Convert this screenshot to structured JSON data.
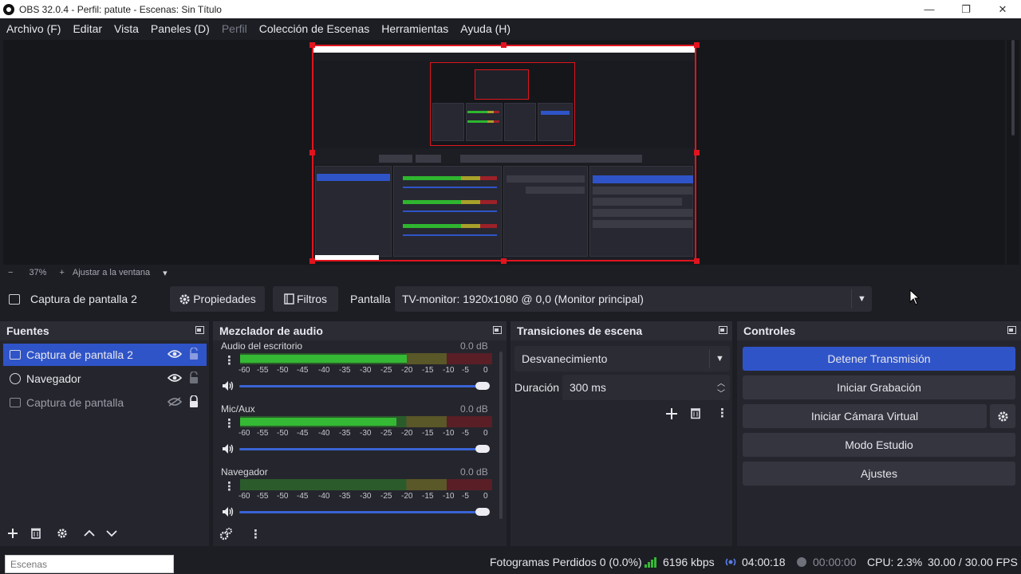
{
  "window": {
    "title": "OBS 32.0.4 - Perfil: patute - Escenas: Sin Título",
    "minimize": "—",
    "restore": "❐",
    "close": "✕"
  },
  "menu": [
    "Archivo (F)",
    "Editar",
    "Vista",
    "Paneles (D)",
    "Perfil",
    "Colección de Escenas",
    "Herramientas",
    "Ayuda (H)"
  ],
  "zoom": {
    "minus": "−",
    "value": "37%",
    "plus": "+",
    "fit": "Ajustar a la ventana",
    "dropdown": "▾"
  },
  "source_toolbar": {
    "selected_source": "Captura de pantalla 2",
    "properties": "Propiedades",
    "filters": "Filtros",
    "display_label": "Pantalla",
    "display_value": "TV-monitor: 1920x1080 @ 0,0 (Monitor principal)"
  },
  "sources": {
    "title": "Fuentes",
    "items": [
      {
        "label": "Captura de pantalla 2",
        "icon": "monitor-icon",
        "visible": true,
        "locked": false,
        "selected": true
      },
      {
        "label": "Navegador",
        "icon": "globe-icon",
        "visible": true,
        "locked": false,
        "selected": false
      },
      {
        "label": "Captura de pantalla",
        "icon": "monitor-icon",
        "visible": false,
        "locked": true,
        "selected": false
      }
    ]
  },
  "mixer": {
    "title": "Mezclador de audio",
    "scale": [
      "-60",
      "-55",
      "-50",
      "-45",
      "-40",
      "-35",
      "-30",
      "-25",
      "-20",
      "-15",
      "-10",
      "-5",
      "0"
    ],
    "channels": [
      {
        "name": "Audio del escritorio",
        "db": "0.0 dB",
        "level": 0.66
      },
      {
        "name": "Mic/Aux",
        "db": "0.0 dB",
        "level": 0.62
      },
      {
        "name": "Navegador",
        "db": "0.0 dB",
        "level": 0.0
      }
    ]
  },
  "transitions": {
    "title": "Transiciones de escena",
    "selected": "Desvanecimiento",
    "duration_label": "Duración",
    "duration_value": "300 ms"
  },
  "controls": {
    "title": "Controles",
    "stop_stream": "Detener Transmisión",
    "start_recording": "Iniciar Grabación",
    "start_virtual_cam": "Iniciar Cámara Virtual",
    "studio_mode": "Modo Estudio",
    "settings": "Ajustes"
  },
  "status": {
    "scenes_placeholder": "Escenas",
    "dropped_frames": "Fotogramas Perdidos 0 (0.0%)",
    "bitrate": "6196 kbps",
    "stream_time": "04:00:18",
    "record_time": "00:00:00",
    "cpu": "CPU: 2.3%",
    "fps": "30.00 / 30.00 FPS"
  },
  "colors": {
    "accent": "#2f54c8",
    "selection_border": "#e1141e",
    "meter_green": "#35b935",
    "meter_yellow": "#a8a12a",
    "meter_red": "#9c2129"
  }
}
